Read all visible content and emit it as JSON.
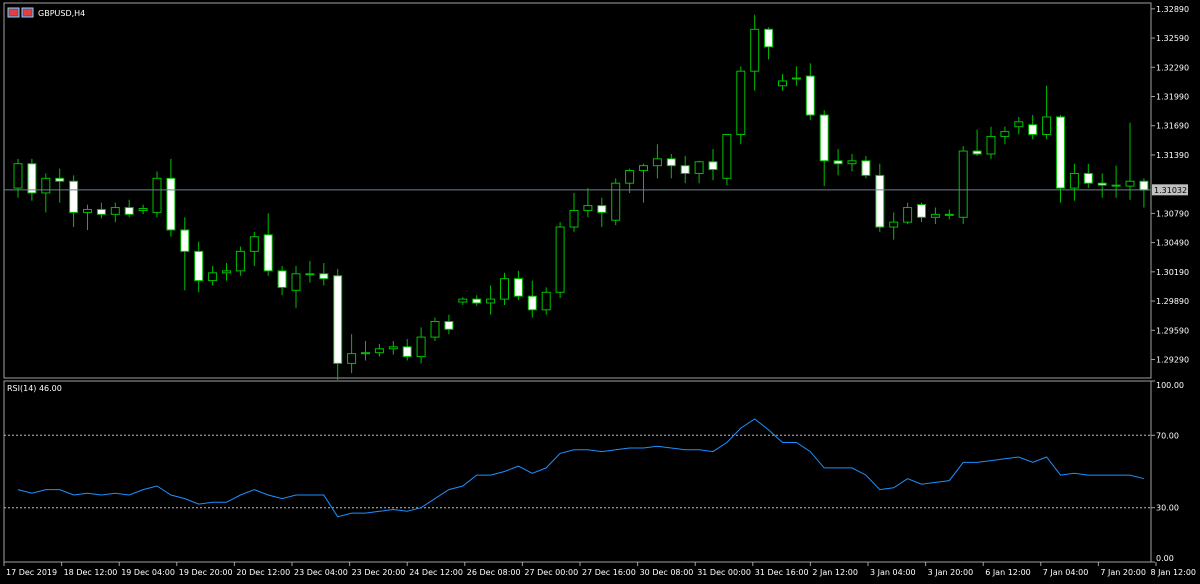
{
  "colors": {
    "background": "#000000",
    "frame": "#a0a0a0",
    "text": "#ffffff",
    "wick": "#00c000",
    "bull_body": "#000000",
    "bear_body": "#ffffff",
    "body_outline": "#00c000",
    "rsi_line": "#1e90ff",
    "bid_line": "#708090",
    "price_tag_bg": "#c0c0c0",
    "price_tag_text": "#000000",
    "level_line": "#c0c0c0"
  },
  "window": {
    "title": "GBPUSD,H4",
    "icons": [
      "buy-icon",
      "sell-icon"
    ]
  },
  "current_price_label": "1.31032",
  "rsi_header": "RSI(14) 46.00",
  "chart_data": [
    {
      "type": "candlestick",
      "title": "GBPUSD,H4",
      "symbol": "GBPUSD",
      "timeframe": "H4",
      "ylim": [
        1.291,
        1.3295
      ],
      "yticks": [
        "1.32890",
        "1.32590",
        "1.32290",
        "1.31990",
        "1.31690",
        "1.31390",
        "1.30790",
        "1.30490",
        "1.30190",
        "1.29890",
        "1.29590",
        "1.29290"
      ],
      "current_price": 1.31032,
      "candles": [
        [
          1.3105,
          1.3135,
          1.3095,
          1.313
        ],
        [
          1.313,
          1.3135,
          1.3092,
          1.31
        ],
        [
          1.31,
          1.312,
          1.308,
          1.3115
        ],
        [
          1.3115,
          1.3125,
          1.309,
          1.3112
        ],
        [
          1.3112,
          1.3118,
          1.3065,
          1.308
        ],
        [
          1.308,
          1.3088,
          1.3062,
          1.3083
        ],
        [
          1.3083,
          1.309,
          1.3074,
          1.3078
        ],
        [
          1.3078,
          1.309,
          1.307,
          1.3085
        ],
        [
          1.3085,
          1.3093,
          1.3075,
          1.3078
        ],
        [
          1.3082,
          1.3088,
          1.3078,
          1.3084
        ],
        [
          1.308,
          1.3122,
          1.3075,
          1.3115
        ],
        [
          1.3115,
          1.3135,
          1.3055,
          1.3062
        ],
        [
          1.3062,
          1.3075,
          1.3,
          1.304
        ],
        [
          1.304,
          1.305,
          1.2998,
          1.301
        ],
        [
          1.301,
          1.3025,
          1.3005,
          1.3018
        ],
        [
          1.3018,
          1.3028,
          1.301,
          1.302
        ],
        [
          1.302,
          1.3045,
          1.3015,
          1.304
        ],
        [
          1.304,
          1.306,
          1.3025,
          1.3055
        ],
        [
          1.3057,
          1.3079,
          1.3015,
          1.302
        ],
        [
          1.302,
          1.3025,
          1.2995,
          1.3003
        ],
        [
          1.3,
          1.3025,
          1.2982,
          1.3017
        ],
        [
          1.3017,
          1.303,
          1.3008,
          1.3017
        ],
        [
          1.3017,
          1.3028,
          1.3005,
          1.3012
        ],
        [
          1.3015,
          1.3022,
          1.2908,
          1.2925
        ],
        [
          1.2925,
          1.2955,
          1.2915,
          1.2935
        ],
        [
          1.2935,
          1.2948,
          1.2928,
          1.2936
        ],
        [
          1.2936,
          1.2945,
          1.2932,
          1.294
        ],
        [
          1.294,
          1.2948,
          1.2934,
          1.2942
        ],
        [
          1.2942,
          1.295,
          1.2928,
          1.2932
        ],
        [
          1.2932,
          1.2962,
          1.2925,
          1.2952
        ],
        [
          1.2952,
          1.2972,
          1.2948,
          1.2968
        ],
        [
          1.2968,
          1.2975,
          1.2955,
          1.296
        ],
        [
          1.2988,
          1.2993,
          1.2985,
          1.2991
        ],
        [
          1.2991,
          1.2995,
          1.2984,
          1.2987
        ],
        [
          1.2987,
          1.3005,
          1.2975,
          1.2991
        ],
        [
          1.2991,
          1.3018,
          1.2985,
          1.3012
        ],
        [
          1.3012,
          1.302,
          1.299,
          1.2994
        ],
        [
          1.2994,
          1.301,
          1.2972,
          1.298
        ],
        [
          1.298,
          1.3003,
          1.2975,
          1.2998
        ],
        [
          1.2998,
          1.307,
          1.2992,
          1.3065
        ],
        [
          1.3065,
          1.31,
          1.306,
          1.3082
        ],
        [
          1.3082,
          1.3105,
          1.3075,
          1.3087
        ],
        [
          1.3087,
          1.3095,
          1.3065,
          1.308
        ],
        [
          1.3072,
          1.3115,
          1.3067,
          1.311
        ],
        [
          1.311,
          1.3125,
          1.31,
          1.3123
        ],
        [
          1.3123,
          1.313,
          1.309,
          1.3128
        ],
        [
          1.3128,
          1.315,
          1.3115,
          1.3135
        ],
        [
          1.3135,
          1.314,
          1.3115,
          1.3128
        ],
        [
          1.3128,
          1.3138,
          1.311,
          1.312
        ],
        [
          1.312,
          1.3133,
          1.311,
          1.3132
        ],
        [
          1.3132,
          1.3145,
          1.3113,
          1.3124
        ],
        [
          1.3115,
          1.316,
          1.3108,
          1.316
        ],
        [
          1.316,
          1.323,
          1.315,
          1.3225
        ],
        [
          1.3225,
          1.3283,
          1.3205,
          1.3268
        ],
        [
          1.3268,
          1.327,
          1.3237,
          1.325
        ],
        [
          1.321,
          1.3222,
          1.3205,
          1.3215
        ],
        [
          1.3218,
          1.323,
          1.321,
          1.3218
        ],
        [
          1.322,
          1.3233,
          1.3175,
          1.318
        ],
        [
          1.318,
          1.3185,
          1.3107,
          1.3133
        ],
        [
          1.3133,
          1.3145,
          1.3118,
          1.313
        ],
        [
          1.313,
          1.314,
          1.3122,
          1.3133
        ],
        [
          1.3133,
          1.3138,
          1.3115,
          1.3118
        ],
        [
          1.3118,
          1.313,
          1.306,
          1.3065
        ],
        [
          1.3065,
          1.308,
          1.3052,
          1.307
        ],
        [
          1.307,
          1.309,
          1.3068,
          1.3085
        ],
        [
          1.3088,
          1.309,
          1.307,
          1.3075
        ],
        [
          1.3075,
          1.3085,
          1.3068,
          1.3078
        ],
        [
          1.3078,
          1.3083,
          1.3073,
          1.3077
        ],
        [
          1.3075,
          1.3148,
          1.3068,
          1.3143
        ],
        [
          1.3143,
          1.3165,
          1.3138,
          1.314
        ],
        [
          1.314,
          1.3168,
          1.3135,
          1.3158
        ],
        [
          1.3158,
          1.3168,
          1.315,
          1.3163
        ],
        [
          1.3168,
          1.3178,
          1.316,
          1.3173
        ],
        [
          1.317,
          1.318,
          1.3155,
          1.316
        ],
        [
          1.316,
          1.321,
          1.3155,
          1.3178
        ],
        [
          1.3178,
          1.318,
          1.309,
          1.3105
        ],
        [
          1.3105,
          1.313,
          1.3092,
          1.312
        ],
        [
          1.312,
          1.313,
          1.3105,
          1.311
        ],
        [
          1.311,
          1.312,
          1.3095,
          1.3108
        ],
        [
          1.3108,
          1.3128,
          1.3095,
          1.3107
        ],
        [
          1.3107,
          1.3172,
          1.3093,
          1.3112
        ],
        [
          1.3112,
          1.3115,
          1.3085,
          1.3103
        ]
      ],
      "x_axis_labels": [
        "17 Dec 2019",
        "18 Dec 12:00",
        "19 Dec 04:00",
        "19 Dec 20:00",
        "20 Dec 12:00",
        "23 Dec 04:00",
        "23 Dec 20:00",
        "24 Dec 12:00",
        "26 Dec 08:00",
        "27 Dec 00:00",
        "27 Dec 16:00",
        "30 Dec 08:00",
        "31 Dec 00:00",
        "31 Dec 16:00",
        "2 Jan 12:00",
        "3 Jan 04:00",
        "3 Jan 20:00",
        "6 Jan 12:00",
        "7 Jan 04:00",
        "7 Jan 20:00",
        "8 Jan 12:00"
      ]
    },
    {
      "type": "line",
      "title": "RSI(14) 46.00",
      "ylim": [
        0,
        100
      ],
      "yticks": [
        "100.00",
        "70.00",
        "30.00",
        "0.00"
      ],
      "levels": [
        70,
        30
      ],
      "series": [
        {
          "values": [
            40,
            38,
            40,
            40,
            37,
            38,
            37,
            38,
            37,
            40,
            42,
            37,
            35,
            32,
            33,
            33,
            37,
            40,
            37,
            35,
            37,
            37,
            37,
            25,
            27,
            27,
            28,
            29,
            28,
            30,
            35,
            40,
            42,
            48,
            48,
            50,
            53,
            49,
            52,
            60,
            62,
            62,
            61,
            62,
            63,
            63,
            64,
            63,
            62,
            62,
            61,
            66,
            74,
            79,
            73,
            66,
            66,
            61,
            52,
            52,
            52,
            48,
            40,
            41,
            46,
            43,
            44,
            45,
            55,
            55,
            56,
            57,
            58,
            55,
            58,
            48,
            49,
            48,
            48,
            48,
            48,
            46
          ]
        }
      ]
    }
  ]
}
